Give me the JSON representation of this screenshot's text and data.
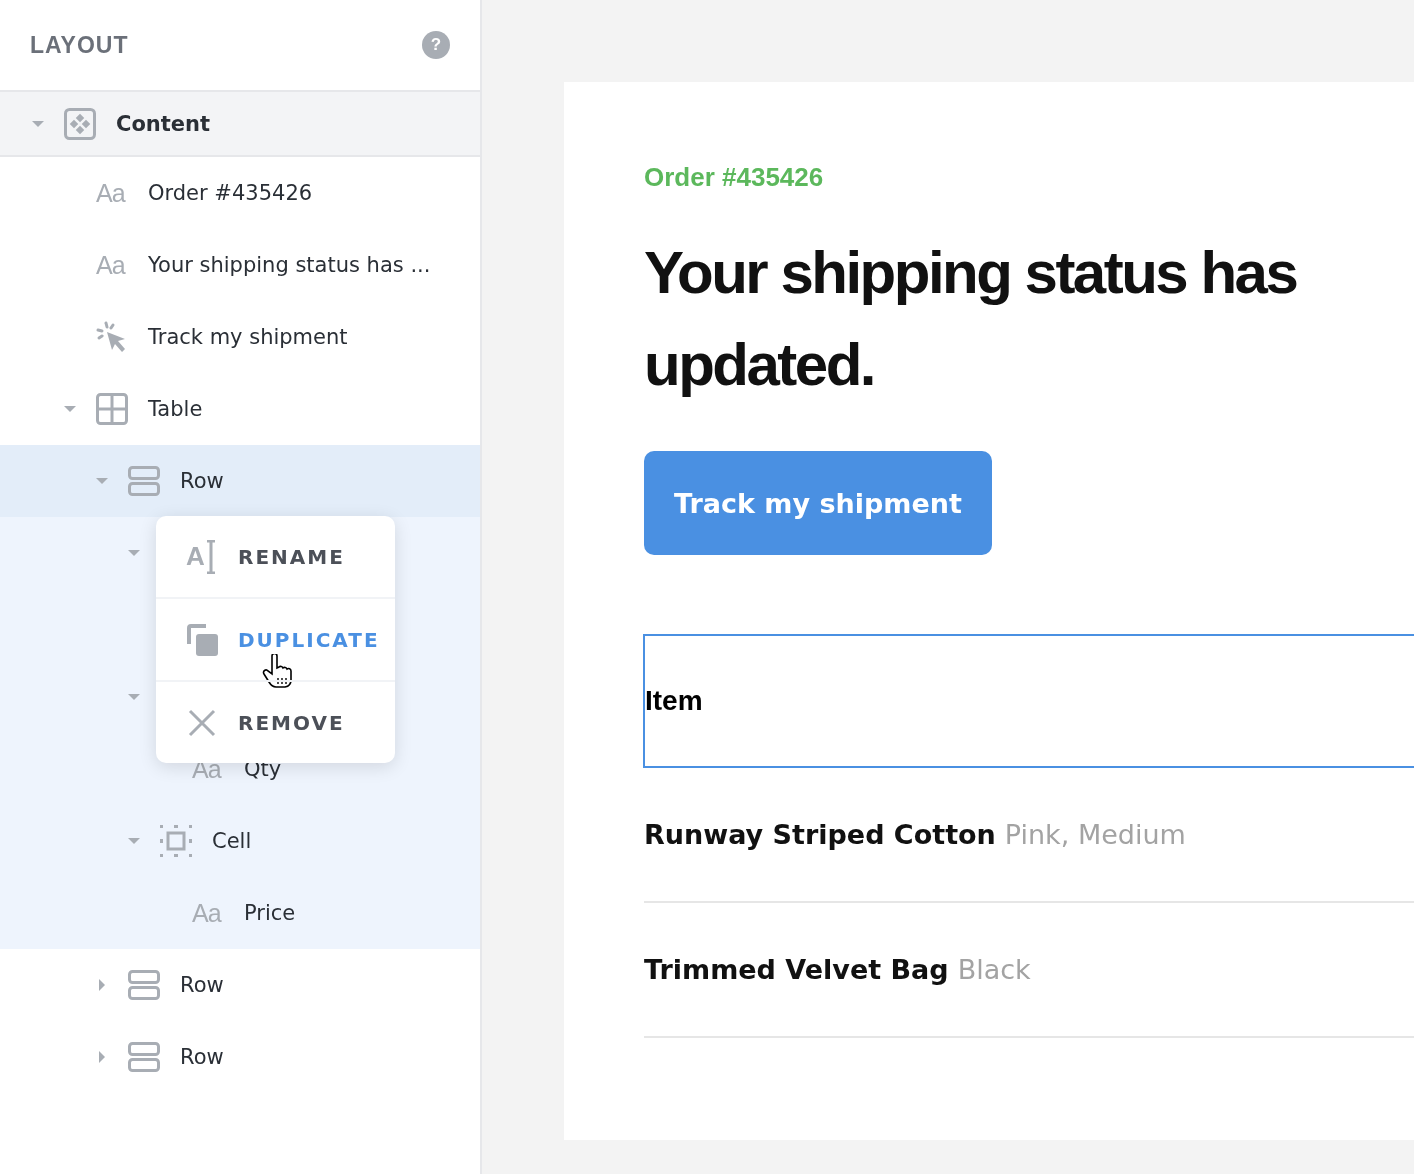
{
  "sidebar": {
    "title": "LAYOUT",
    "help": "?",
    "tree": [
      {
        "label": "Content",
        "kind": "content",
        "expanded": true,
        "children": [
          {
            "label": "Order #435426",
            "kind": "text",
            "glyph": "Aa"
          },
          {
            "label": "Your shipping status has ...",
            "kind": "text",
            "glyph": "Aa"
          },
          {
            "label": "Track my shipment",
            "kind": "button"
          },
          {
            "label": "Table",
            "kind": "table",
            "expanded": true,
            "children": [
              {
                "label": "Row",
                "kind": "row",
                "expanded": true,
                "selected": true,
                "children": [
                  {
                    "expanded": true,
                    "children": [
                      {
                        "kind": "covered"
                      }
                    ]
                  },
                  {
                    "expanded": true,
                    "children": [
                      {
                        "label": "Qty",
                        "kind": "text",
                        "glyph": "Aa"
                      }
                    ]
                  },
                  {
                    "label": "Cell",
                    "kind": "cell",
                    "expanded": true,
                    "children": [
                      {
                        "label": "Price",
                        "kind": "text",
                        "glyph": "Aa"
                      }
                    ]
                  }
                ]
              },
              {
                "label": "Row",
                "kind": "row",
                "expanded": false,
                "selected": false
              },
              {
                "label": "Row",
                "kind": "row",
                "expanded": false,
                "selected": false
              }
            ]
          }
        ]
      }
    ]
  },
  "context_menu": {
    "items": [
      {
        "label": "RENAME",
        "kind": "rename",
        "glyph": "A",
        "hovered": false
      },
      {
        "label": "DUPLICATE",
        "kind": "duplicate",
        "hovered": true
      },
      {
        "label": "REMOVE",
        "kind": "remove",
        "hovered": false
      }
    ]
  },
  "preview": {
    "order": "Order #435426",
    "heading": [
      "Your shipping status has",
      "updated."
    ],
    "button": "Track my shipment",
    "table": {
      "header": "Item",
      "rows": [
        {
          "name": "Runway Striped Cotton",
          "variant": "Pink, Medium"
        },
        {
          "name": "Trimmed Velvet Bag",
          "variant": "Black"
        }
      ]
    }
  }
}
